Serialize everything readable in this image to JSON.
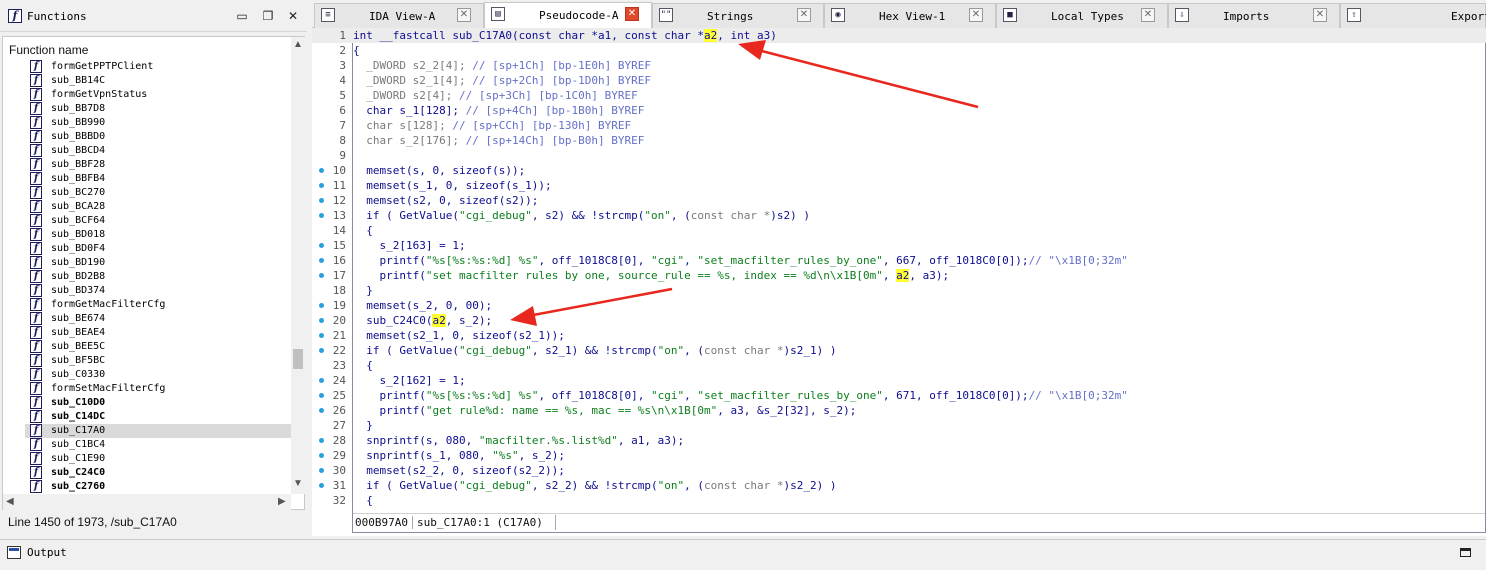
{
  "functions_panel": {
    "title": "Functions",
    "column_header": "Function name",
    "items": [
      {
        "name": "formGetPPTPClient",
        "bold": false
      },
      {
        "name": "sub_BB14C",
        "bold": false
      },
      {
        "name": "formGetVpnStatus",
        "bold": false
      },
      {
        "name": "sub_BB7D8",
        "bold": false
      },
      {
        "name": "sub_BB990",
        "bold": false
      },
      {
        "name": "sub_BBBD0",
        "bold": false
      },
      {
        "name": "sub_BBCD4",
        "bold": false
      },
      {
        "name": "sub_BBF28",
        "bold": false
      },
      {
        "name": "sub_BBFB4",
        "bold": false
      },
      {
        "name": "sub_BC270",
        "bold": false
      },
      {
        "name": "sub_BCA28",
        "bold": false
      },
      {
        "name": "sub_BCF64",
        "bold": false
      },
      {
        "name": "sub_BD018",
        "bold": false
      },
      {
        "name": "sub_BD0F4",
        "bold": false
      },
      {
        "name": "sub_BD190",
        "bold": false
      },
      {
        "name": "sub_BD2B8",
        "bold": false
      },
      {
        "name": "sub_BD374",
        "bold": false
      },
      {
        "name": "formGetMacFilterCfg",
        "bold": false
      },
      {
        "name": "sub_BE674",
        "bold": false
      },
      {
        "name": "sub_BEAE4",
        "bold": false
      },
      {
        "name": "sub_BEE5C",
        "bold": false
      },
      {
        "name": "sub_BF5BC",
        "bold": false
      },
      {
        "name": "sub_C0330",
        "bold": false
      },
      {
        "name": "formSetMacFilterCfg",
        "bold": false
      },
      {
        "name": "sub_C10D0",
        "bold": true
      },
      {
        "name": "sub_C14DC",
        "bold": true
      },
      {
        "name": "sub_C17A0",
        "bold": false,
        "selected": true
      },
      {
        "name": "sub_C1BC4",
        "bold": false
      },
      {
        "name": "sub_C1E90",
        "bold": false
      },
      {
        "name": "sub_C24C0",
        "bold": true
      },
      {
        "name": "sub_C2760",
        "bold": true
      }
    ],
    "status": "Line 1450 of 1973, /sub_C17A0"
  },
  "tabs": [
    {
      "label": "IDA View-A",
      "active": false,
      "icon": "ida-view-icon"
    },
    {
      "label": "Pseudocode-A",
      "active": true,
      "icon": "pseudocode-icon"
    },
    {
      "label": "Strings",
      "active": false,
      "icon": "strings-icon"
    },
    {
      "label": "Hex View-1",
      "active": false,
      "icon": "hex-view-icon"
    },
    {
      "label": "Local Types",
      "active": false,
      "icon": "local-types-icon"
    },
    {
      "label": "Imports",
      "active": false,
      "icon": "imports-icon"
    },
    {
      "label": "Exports",
      "active": false,
      "icon": "exports-icon"
    }
  ],
  "code": {
    "lines": [
      {
        "n": "1",
        "dot": false,
        "hl": true,
        "text": "int __fastcall sub_C17A0(const char *a1, const char *a2, int a3)"
      },
      {
        "n": "2",
        "dot": false,
        "hl": false,
        "text": "{"
      },
      {
        "n": "3",
        "dot": false,
        "hl": false,
        "text": "  _DWORD s2_2[4]; // [sp+1Ch] [bp-1E0h] BYREF"
      },
      {
        "n": "4",
        "dot": false,
        "hl": false,
        "text": "  _DWORD s2_1[4]; // [sp+2Ch] [bp-1D0h] BYREF"
      },
      {
        "n": "5",
        "dot": false,
        "hl": false,
        "text": "  _DWORD s2[4]; // [sp+3Ch] [bp-1C0h] BYREF"
      },
      {
        "n": "6",
        "dot": false,
        "hl": false,
        "text": "  char s_1[128]; // [sp+4Ch] [bp-1B0h] BYREF"
      },
      {
        "n": "7",
        "dot": false,
        "hl": false,
        "text": "  char s[128]; // [sp+CCh] [bp-130h] BYREF"
      },
      {
        "n": "8",
        "dot": false,
        "hl": false,
        "text": "  char s_2[176]; // [sp+14Ch] [bp-B0h] BYREF"
      },
      {
        "n": "9",
        "dot": false,
        "hl": false,
        "text": ""
      },
      {
        "n": "10",
        "dot": true,
        "hl": false,
        "text": "  memset(s, 0, sizeof(s));"
      },
      {
        "n": "11",
        "dot": true,
        "hl": false,
        "text": "  memset(s_1, 0, sizeof(s_1));"
      },
      {
        "n": "12",
        "dot": true,
        "hl": false,
        "text": "  memset(s2, 0, sizeof(s2));"
      },
      {
        "n": "13",
        "dot": true,
        "hl": false,
        "text": "  if ( GetValue(\"cgi_debug\", s2) && !strcmp(\"on\", (const char *)s2) )"
      },
      {
        "n": "14",
        "dot": false,
        "hl": false,
        "text": "  {"
      },
      {
        "n": "15",
        "dot": true,
        "hl": false,
        "text": "    s_2[163] = 1;"
      },
      {
        "n": "16",
        "dot": true,
        "hl": false,
        "text": "    printf(\"%s[%s:%s:%d] %s\", off_1018C8[0], \"cgi\", \"set_macfilter_rules_by_one\", 667, off_1018C0[0]);// \"\\x1B[0;32m\""
      },
      {
        "n": "17",
        "dot": true,
        "hl": false,
        "text": "    printf(\"set macfilter rules by one, source_rule == %s, index == %d\\n\\x1B[0m\", a2, a3);"
      },
      {
        "n": "18",
        "dot": false,
        "hl": false,
        "text": "  }"
      },
      {
        "n": "19",
        "dot": true,
        "hl": false,
        "text": "  memset(s_2, 0, 0xA0u);"
      },
      {
        "n": "20",
        "dot": true,
        "hl": false,
        "text": "  sub_C24C0(a2, s_2);"
      },
      {
        "n": "21",
        "dot": true,
        "hl": false,
        "text": "  memset(s2_1, 0, sizeof(s2_1));"
      },
      {
        "n": "22",
        "dot": true,
        "hl": false,
        "text": "  if ( GetValue(\"cgi_debug\", s2_1) && !strcmp(\"on\", (const char *)s2_1) )"
      },
      {
        "n": "23",
        "dot": false,
        "hl": false,
        "text": "  {"
      },
      {
        "n": "24",
        "dot": true,
        "hl": false,
        "text": "    s_2[162] = 1;"
      },
      {
        "n": "25",
        "dot": true,
        "hl": false,
        "text": "    printf(\"%s[%s:%s:%d] %s\", off_1018C8[0], \"cgi\", \"set_macfilter_rules_by_one\", 671, off_1018C0[0]);// \"\\x1B[0;32m\""
      },
      {
        "n": "26",
        "dot": true,
        "hl": false,
        "text": "    printf(\"get rule%d: name == %s, mac == %s\\n\\x1B[0m\", a3, &s_2[32], s_2);"
      },
      {
        "n": "27",
        "dot": false,
        "hl": false,
        "text": "  }"
      },
      {
        "n": "28",
        "dot": true,
        "hl": false,
        "text": "  snprintf(s, 0x80u, \"macfilter.%s.list%d\", a1, a3);"
      },
      {
        "n": "29",
        "dot": true,
        "hl": false,
        "text": "  snprintf(s_1, 0x80u, \"%s\", s_2);"
      },
      {
        "n": "30",
        "dot": true,
        "hl": false,
        "text": "  memset(s2_2, 0, sizeof(s2_2));"
      },
      {
        "n": "31",
        "dot": true,
        "hl": false,
        "text": "  if ( GetValue(\"cgi_debug\", s2_2) && !strcmp(\"on\", (const char *)s2_2) )"
      },
      {
        "n": "32",
        "dot": false,
        "hl": false,
        "text": "  {"
      }
    ],
    "highlight_token": "a2",
    "footer_address": "000B97A0",
    "footer_location": "sub_C17A0:1 (C17A0)"
  },
  "output_panel": {
    "title": "Output"
  },
  "colors": {
    "keyword": "#0d0d8f",
    "comment": "#6470c8",
    "string": "#0d7e1d",
    "highlight": "#ffff30",
    "annotation_arrow": "#e8281e"
  }
}
